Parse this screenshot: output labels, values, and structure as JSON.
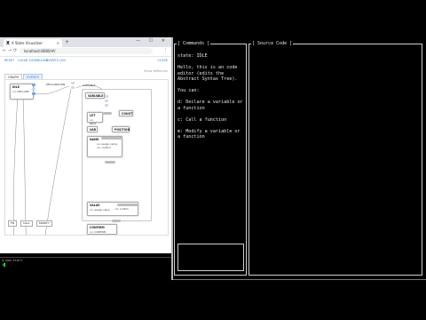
{
  "browser": {
    "tab_title": "X State Visualizer",
    "new_tab_symbol": "+",
    "window_controls": "— ☐ ✕",
    "url": "localhost:8080/#/",
    "nav": {
      "back": "←",
      "forward": "→",
      "reload": "⟳"
    },
    "menu": "⋮",
    "toolbar": {
      "items": [
        "RESET",
        "CLEAR",
        "DOWNLOAD",
        "EVENTS LOG"
      ],
      "close": "CLOSE"
    },
    "hint": "Show definition",
    "view_tabs": [
      "GRAPH",
      "EVENTS"
    ]
  },
  "diagram": {
    "idle_node": {
      "title": "IDLE",
      "rows": [
        "on: DECLARE",
        "on: CALL",
        "on: MODIFY"
      ]
    },
    "declaration_label": "DECLARATION",
    "variable_label": "VARIABLE",
    "variable_node": {
      "title": "VARIABLE"
    },
    "let_node": {
      "title": "LET",
      "rows": [
        "on: NEXT"
      ]
    },
    "const_node": {
      "title": "CONST"
    },
    "var_node": {
      "title": "VAR"
    },
    "position_node": {
      "title": "POSITION"
    },
    "name_node": {
      "title": "NAME",
      "rows": [
        "on: assign.name",
        "on: confirm"
      ]
    },
    "value_node": {
      "title": "VALUE",
      "rows": [
        "on: assign.value",
        "on: confirm"
      ]
    },
    "confirm_node": {
      "title": "CONFIRM",
      "rows": [
        "on: CONFIRM",
        "on: assign.name",
        "on: assign.value",
        "on: confirm",
        "on: CANCEL"
      ]
    },
    "bottom_nodes": [
      "FN",
      "CALL",
      "MODIFY"
    ]
  },
  "terminal": {
    "lines": [
      "$ npm start",
      ">"
    ]
  },
  "commands_panel": {
    "title": "[ Commands ]",
    "state_line": "state: IDLE",
    "paragraphs": [
      "Hello, this is an code editor (edits the Abstract Syntax Tree).",
      "You can:",
      "d: Declare a variable or a function",
      "c: Call a function",
      "m: Modify a variable or a function"
    ]
  },
  "source_panel": {
    "title": "[ Source Code ]"
  }
}
